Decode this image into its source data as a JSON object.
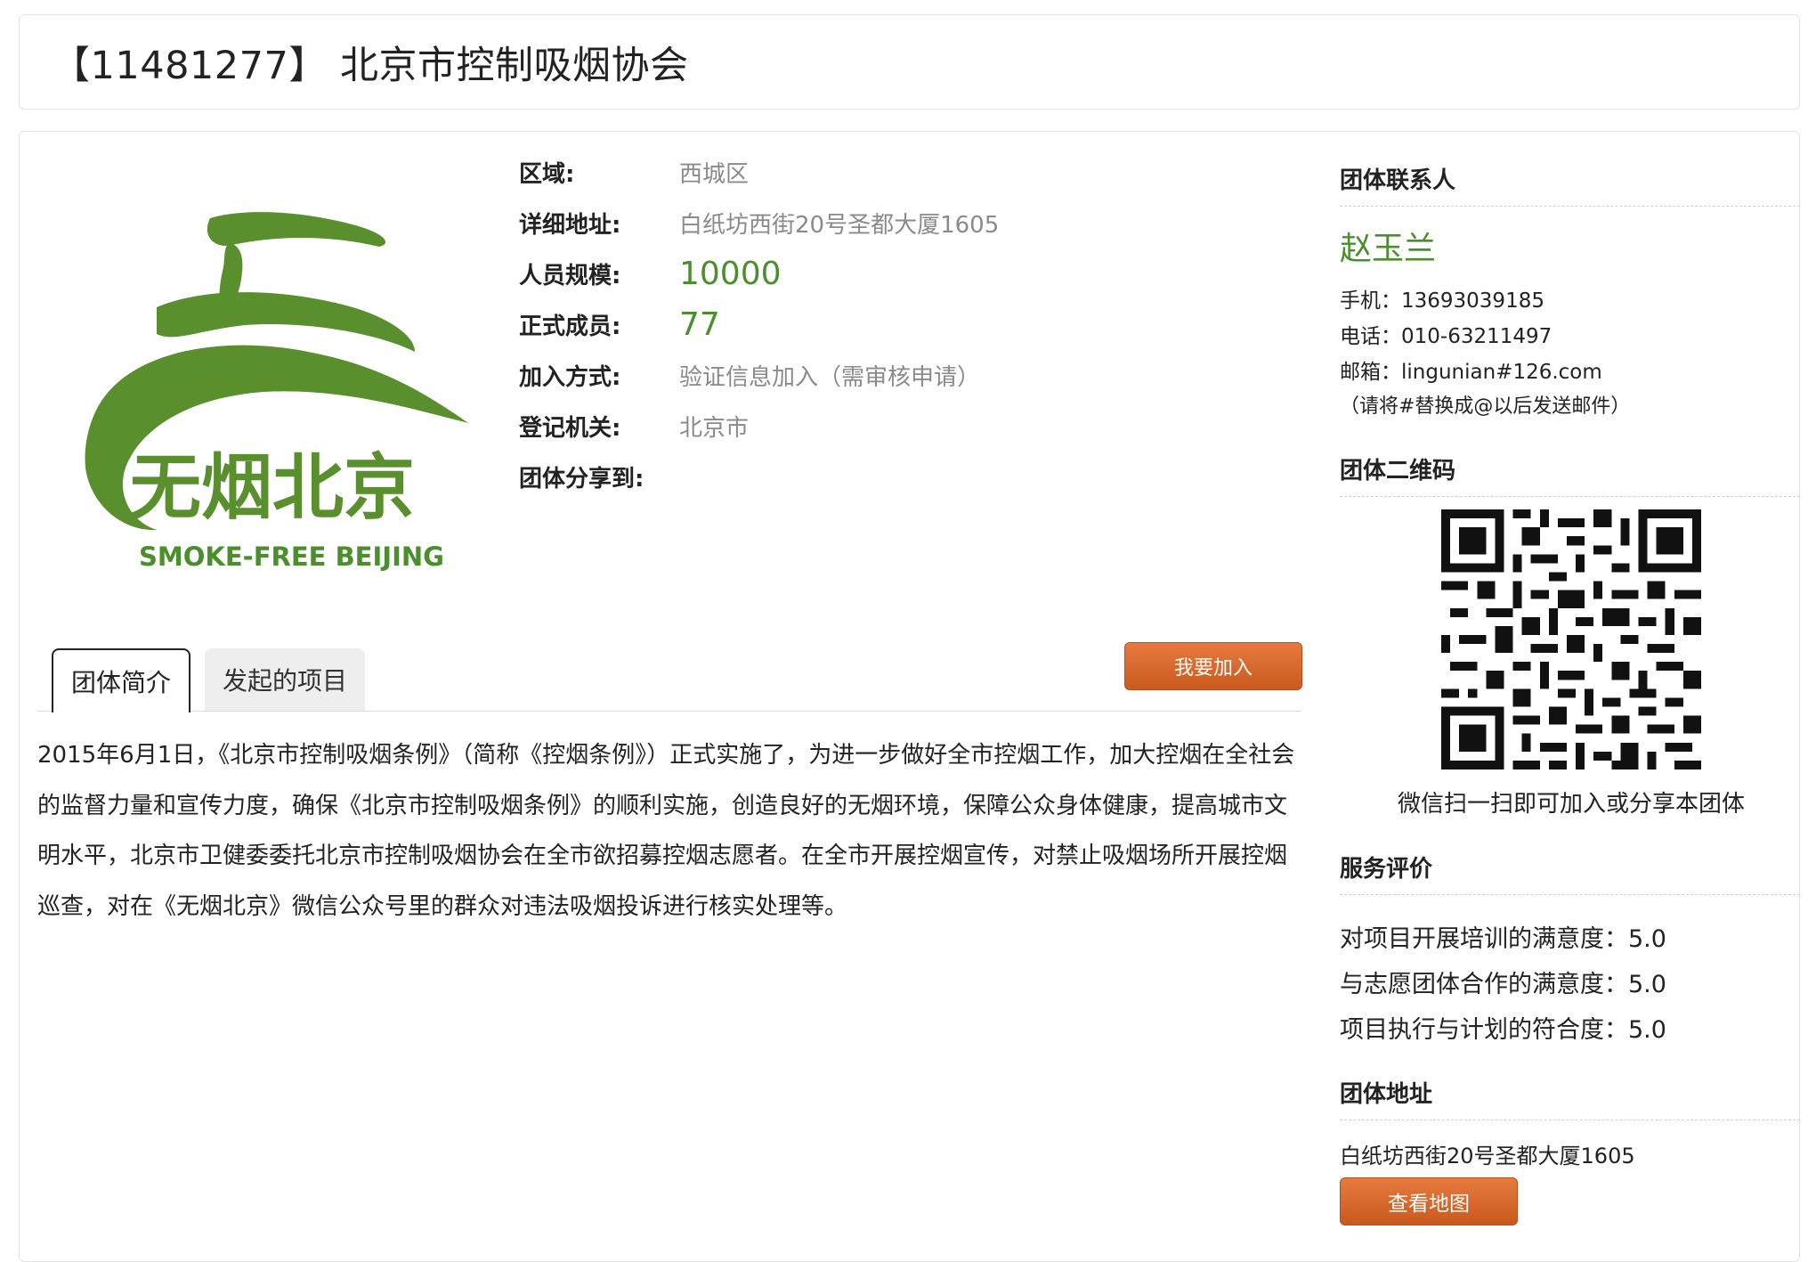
{
  "header": {
    "title": "【11481277】 北京市控制吸烟协会"
  },
  "logo": {
    "cn": "无烟北京",
    "en": "SMOKE-FREE BEIJING",
    "color": "#5a8f2d"
  },
  "info": [
    {
      "label": "区域:",
      "value": "西城区"
    },
    {
      "label": "详细地址:",
      "value": "白纸坊西街20号圣都大厦1605"
    },
    {
      "label": "人员规模:",
      "value": "10000"
    },
    {
      "label": "正式成员:",
      "value": "77"
    },
    {
      "label": "加入方式:",
      "value": "验证信息加入（需审核申请）"
    },
    {
      "label": "登记机关:",
      "value": "北京市"
    },
    {
      "label": "团体分享到:",
      "value": ""
    }
  ],
  "tabs": [
    {
      "label": "团体简介"
    },
    {
      "label": "发起的项目"
    }
  ],
  "join_button": "我要加入",
  "description": "2015年6月1日，《北京市控制吸烟条例》（简称《控烟条例》）正式实施了，为进一步做好全市控烟工作，加大控烟在全社会的监督力量和宣传力度，确保《北京市控制吸烟条例》的顺利实施，创造良好的无烟环境，保障公众身体健康，提高城市文明水平，北京市卫健委委托北京市控制吸烟协会在全市欲招募控烟志愿者。在全市开展控烟宣传，对禁止吸烟场所开展控烟巡查，对在《无烟北京》微信公众号里的群众对违法吸烟投诉进行核实处理等。",
  "contact": {
    "section_title": "团体联系人",
    "name": "赵玉兰",
    "mobile": "手机：13693039185",
    "phone": "电话：010-63211497",
    "email": "邮箱：lingunian#126.com",
    "note": "（请将#替换成@以后发送邮件）"
  },
  "qr": {
    "section_title": "团体二维码",
    "caption": "微信扫一扫即可加入或分享本团体"
  },
  "rating": {
    "section_title": "服务评价",
    "items": [
      "对项目开展培训的满意度：5.0",
      "与志愿团体合作的满意度：5.0",
      "项目执行与计划的符合度：5.0"
    ]
  },
  "address": {
    "section_title": "团体地址",
    "text": "白纸坊西街20号圣都大厦1605",
    "map_button": "查看地图"
  },
  "colors": {
    "accent_green": "#4a8f2c",
    "button_orange": "#d9672b"
  }
}
